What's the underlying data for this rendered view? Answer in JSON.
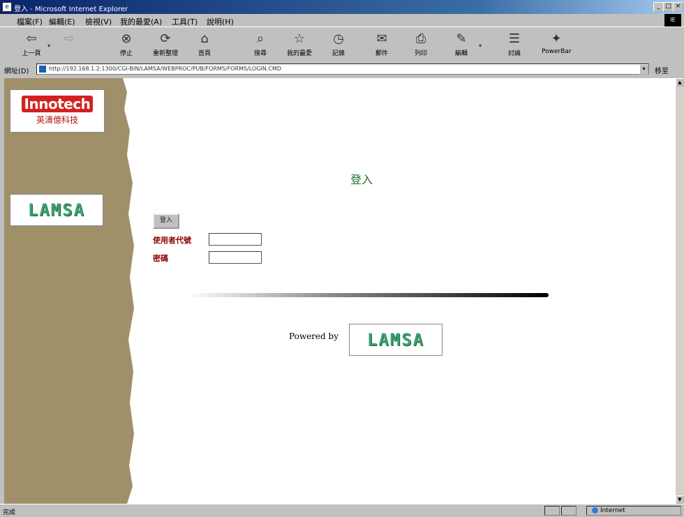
{
  "window": {
    "title": "登入 - Microsoft Internet Explorer",
    "min": "_",
    "max": "□",
    "close": "×",
    "throbber": "IE"
  },
  "menu": [
    "檔案(F)",
    "編輯(E)",
    "檢視(V)",
    "我的最愛(A)",
    "工具(T)",
    "說明(H)"
  ],
  "toolbar": {
    "back": "上一頁",
    "forward": "",
    "stop": "停止",
    "refresh": "重新整理",
    "home": "首頁",
    "search": "搜尋",
    "favorites": "我的最愛",
    "history": "記錄",
    "mail": "郵件",
    "print": "列印",
    "edit": "編輯",
    "discuss": "討論",
    "extra": "PowerBar",
    "drop": "▾"
  },
  "address": {
    "label": "網址(D)",
    "url": "http://192.168.1.2:1300/CGI-BIN/LAMSA/WEBPROC/PUB/FORMS/FORMS/LOGIN.CMD",
    "go": "移至",
    "dropdown": "▾"
  },
  "sidebar": {
    "logo_en": "Innotech",
    "logo_zh": "英濤億科技",
    "logo_brand": "LAMSA"
  },
  "login": {
    "title": "登入",
    "submit_label": "登入",
    "username_label": "使用者代號",
    "username_value": "",
    "password_label": "密碼",
    "password_value": ""
  },
  "footer": {
    "powered_by": "Powered by",
    "brand": "LAMSA"
  },
  "status": {
    "text": "完成",
    "zone": "Internet"
  },
  "colors": {
    "sidebar": "#a0906a",
    "title_green": "#1f6b2a",
    "label_red": "#8b0000",
    "brand_green": "#3aa070"
  }
}
